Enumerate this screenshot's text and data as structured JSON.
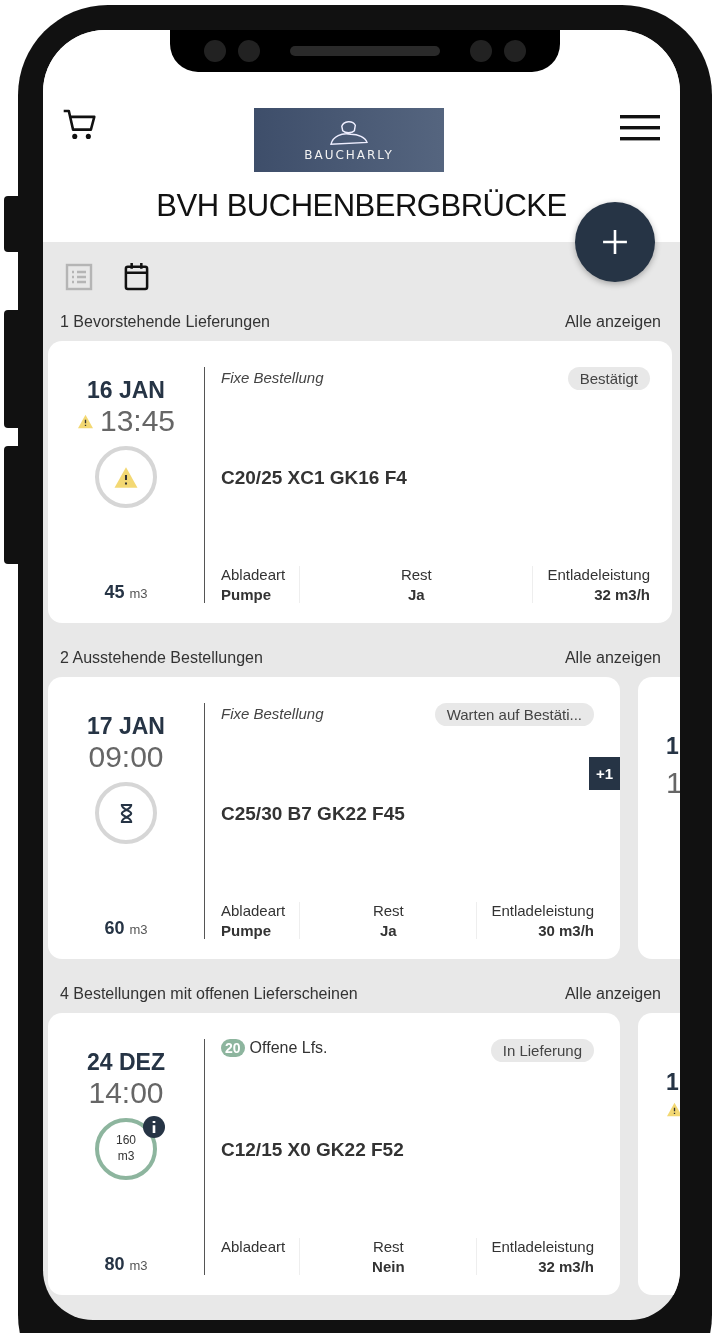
{
  "header": {
    "logo_text": "BAUCHARLY",
    "title": "BVH BUCHENBERGBRÜCKE"
  },
  "view_toggle": [
    {
      "kind": "list",
      "selected": false
    },
    {
      "kind": "calendar",
      "selected": true
    }
  ],
  "sections": [
    {
      "heading": "1 Bevorstehende Lieferungen",
      "link": "Alle anzeigen",
      "cards": [
        {
          "date": "16 JAN",
          "time": "13:45",
          "time_warning": true,
          "indicator": {
            "kind": "warning"
          },
          "volume": "45",
          "unit": "m3",
          "top": {
            "kind": "order_type",
            "text": "Fixe Bestellung"
          },
          "status": "Bestätigt",
          "product": "C20/25 XC1 GK16 F4",
          "fields": [
            {
              "label": "Abladeart",
              "value": "Pumpe"
            },
            {
              "label": "Rest",
              "value": "Ja"
            },
            {
              "label": "Entladeleistung",
              "value": "32 m3/h"
            }
          ]
        }
      ]
    },
    {
      "heading": "2 Ausstehende Bestellungen",
      "link": "Alle anzeigen",
      "cards": [
        {
          "date": "17 JAN",
          "time": "09:00",
          "time_warning": false,
          "indicator": {
            "kind": "pending"
          },
          "volume": "60",
          "unit": "m3",
          "top": {
            "kind": "order_type",
            "text": "Fixe Bestellung"
          },
          "status": "Warten auf Bestäti...",
          "product": "C25/30 B7 GK22 F45",
          "extra": "+1",
          "fields": [
            {
              "label": "Abladeart",
              "value": "Pumpe"
            },
            {
              "label": "Rest",
              "value": "Ja"
            },
            {
              "label": "Entladeleistung",
              "value": "30 m3/h"
            }
          ]
        }
      ],
      "peek": {
        "date": "1",
        "time": "1"
      }
    },
    {
      "heading": "4 Bestellungen mit offenen Lieferscheinen",
      "link": "Alle anzeigen",
      "cards": [
        {
          "date": "24 DEZ",
          "time": "14:00",
          "time_warning": false,
          "indicator": {
            "kind": "volume",
            "value": "160",
            "unit": "m3",
            "info": true
          },
          "volume": "80",
          "unit": "m3",
          "top": {
            "kind": "open_slips",
            "count": "20",
            "text": "Offene Lfs."
          },
          "status": "In Lieferung",
          "product": "C12/15 X0 GK22 F52",
          "fields": [
            {
              "label": "Abladeart"
            },
            {
              "label": "Rest",
              "value": "Nein"
            },
            {
              "label": "Entladeleistung",
              "value": "32 m3/h"
            }
          ]
        }
      ],
      "peek": {
        "date": "1",
        "time_warning": true
      }
    }
  ]
}
